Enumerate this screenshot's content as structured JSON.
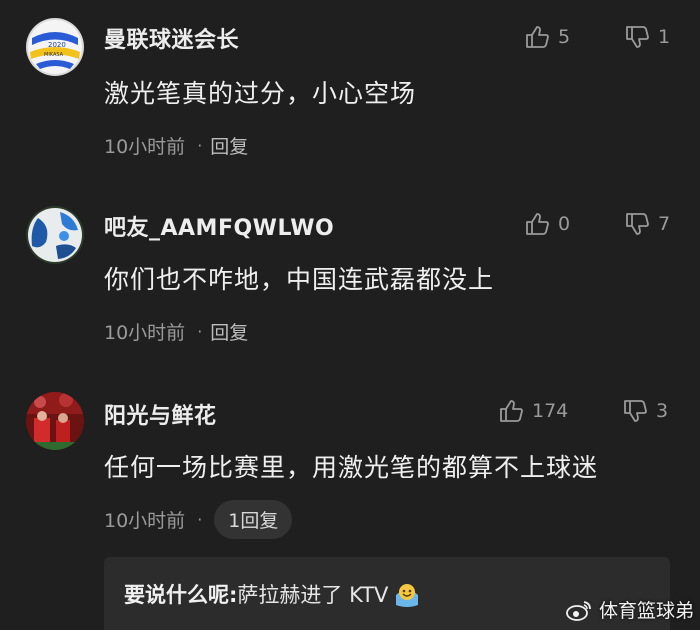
{
  "comments": [
    {
      "username": "曼联球迷会长",
      "text": "激光笔真的过分，小心空场",
      "time": "10小时前",
      "reply_label": "回复",
      "likes": "5",
      "dislikes": "1"
    },
    {
      "username": "吧友_AAMFQWLWO",
      "text": "你们也不咋地，中国连武磊都没上",
      "time": "10小时前",
      "reply_label": "回复",
      "likes": "0",
      "dislikes": "7"
    },
    {
      "username": "阳光与鲜花",
      "text": "任何一场比赛里，用激光笔的都算不上球迷",
      "time": "10小时前",
      "reply_label": "1回复",
      "likes": "174",
      "dislikes": "3"
    }
  ],
  "summary": {
    "label": "要说什么呢:",
    "text": "萨拉赫进了 KTV"
  },
  "watermark": {
    "text": "体育篮球弟"
  },
  "meta_separator": "·",
  "colors": {
    "background": "#1f1f1f",
    "text": "#efefef",
    "muted": "#9a9a9a",
    "pill": "#333333"
  }
}
